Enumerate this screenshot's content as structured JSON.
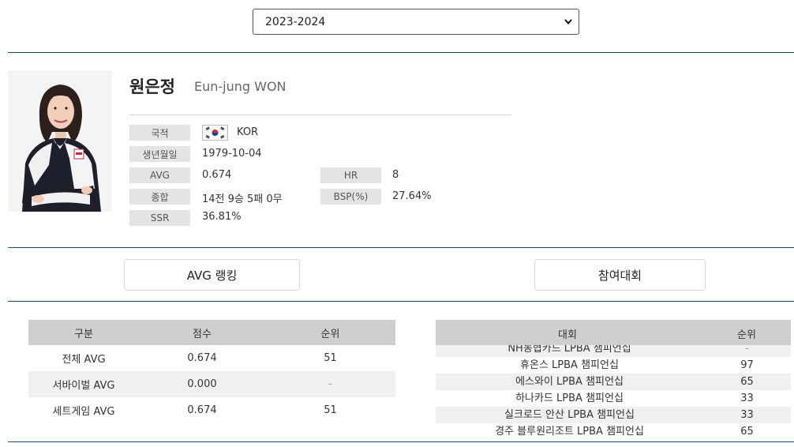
{
  "season": {
    "selected": "2023-2024"
  },
  "player": {
    "name_kr": "원은정",
    "name_en": "Eun-jung WON",
    "nationality_label": "국적",
    "nationality_value": "KOR",
    "birth_label": "생년월일",
    "birth_value": "1979-10-04",
    "avg_label": "AVG",
    "avg_value": "0.674",
    "hr_label": "HR",
    "hr_value": "8",
    "record_label": "종합",
    "record_value": "14전 9승 5패 0무",
    "bsp_label": "BSP(%)",
    "bsp_value": "27.64%",
    "ssr_label": "SSR",
    "ssr_value": "36.81%"
  },
  "tabs": {
    "avg_ranking": "AVG 랭킹",
    "tournaments": "참여대회"
  },
  "rank_table": {
    "headers": [
      "구분",
      "점수",
      "순위"
    ],
    "rows": [
      {
        "category": "전체 AVG",
        "score": "0.674",
        "rank": "51"
      },
      {
        "category": "서바이벌 AVG",
        "score": "0.000",
        "rank": "-"
      },
      {
        "category": "세트게임 AVG",
        "score": "0.674",
        "rank": "51"
      }
    ]
  },
  "tournament_table": {
    "headers": [
      "대회",
      "순위"
    ],
    "rows": [
      {
        "name": "NH농협카드 LPBA 챔피언십",
        "rank": "-"
      },
      {
        "name": "휴온스 LPBA 챔피언십",
        "rank": "97"
      },
      {
        "name": "에스와이 LPBA 챔피언십",
        "rank": "65"
      },
      {
        "name": "하나카드 LPBA 챔피언십",
        "rank": "33"
      },
      {
        "name": "실크로드 안산 LPBA 챔피언십",
        "rank": "33"
      },
      {
        "name": "경주 블루원리조트 LPBA 챔피언십",
        "rank": "65"
      }
    ]
  }
}
